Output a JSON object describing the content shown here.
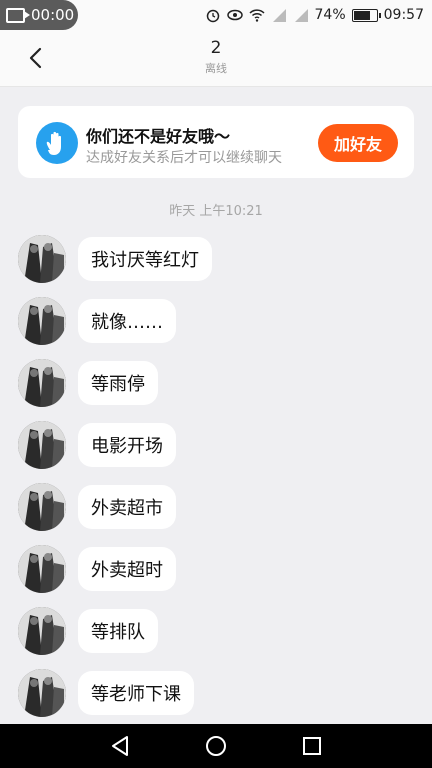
{
  "status_bar": {
    "recording_time": "00:00",
    "battery_percent": "74%",
    "clock": "09:57"
  },
  "header": {
    "title": "2",
    "subtitle": "离线"
  },
  "friend_prompt": {
    "title": "你们还不是好友哦～",
    "subtitle": "达成好友关系后才可以继续聊天",
    "button_label": "加好友"
  },
  "timestamp": "昨天 上午10:21",
  "messages": [
    {
      "text": "我讨厌等红灯"
    },
    {
      "text": "就像……"
    },
    {
      "text": "等雨停"
    },
    {
      "text": "电影开场"
    },
    {
      "text": "外卖超市"
    },
    {
      "text": "外卖超时"
    },
    {
      "text": "等排队"
    },
    {
      "text": "等老师下课"
    }
  ],
  "colors": {
    "accent": "#ff5a14",
    "hand_icon_bg": "#27a1ee",
    "chat_bg": "#efeff2"
  }
}
